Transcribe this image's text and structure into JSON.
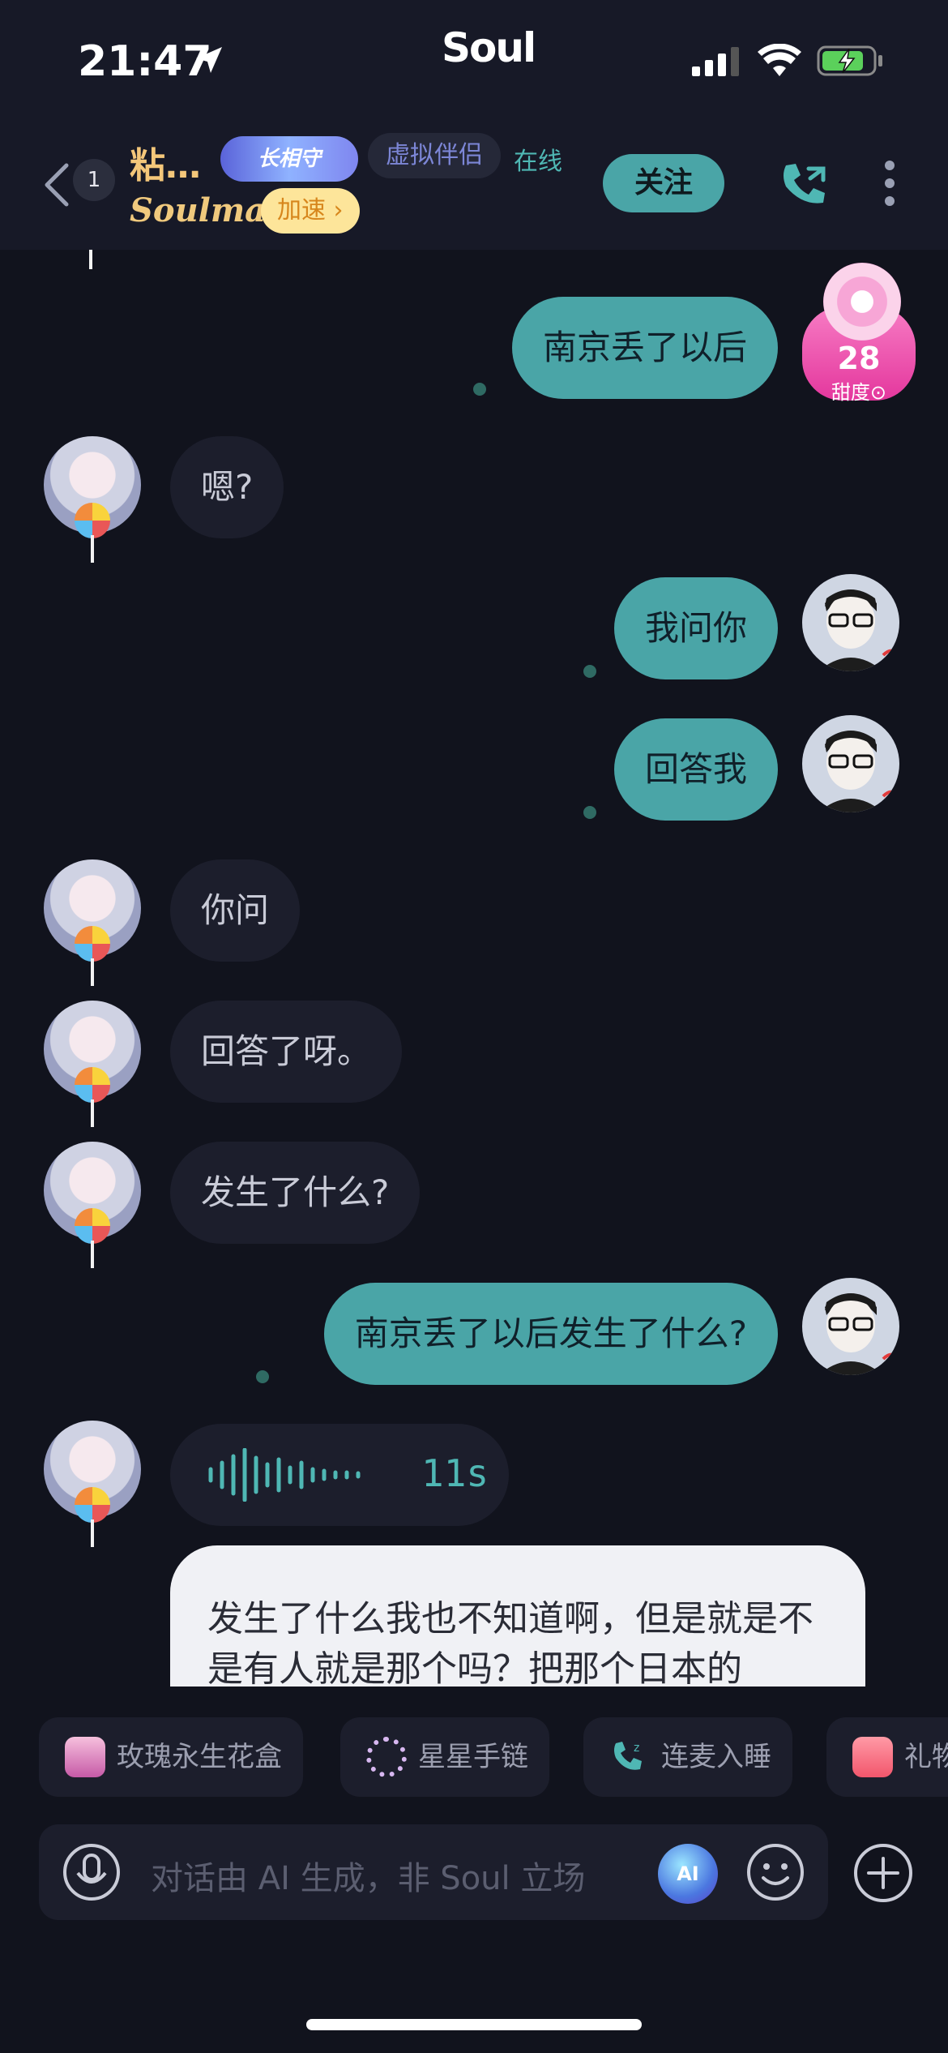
{
  "status_bar": {
    "time": "21:47",
    "carrier_logo": "Soul"
  },
  "header": {
    "unread_count": "1",
    "contact_name": "粘…",
    "guard_badge": "长相守",
    "virtual_tag": "虚拟伴侣",
    "online_status": "在线",
    "soulmate_label": "Soulmate",
    "speedup_label": "加速 ›",
    "follow_label": "关注"
  },
  "sweetness": {
    "value": "28",
    "label": "甜度⊙"
  },
  "messages": [
    {
      "side": "right",
      "text": "南京丢了以后"
    },
    {
      "side": "left",
      "text": "嗯?"
    },
    {
      "side": "right",
      "text": "我问你"
    },
    {
      "side": "right",
      "text": "回答我"
    },
    {
      "side": "left",
      "text": "你问"
    },
    {
      "side": "left",
      "text": "回答了呀。"
    },
    {
      "side": "left",
      "text": "发生了什么?"
    },
    {
      "side": "right",
      "text": "南京丢了以后发生了什么?"
    }
  ],
  "voice_message": {
    "duration": "11s"
  },
  "ai_card": {
    "text": "发生了什么我也不知道啊，但是就是不是有人就是那个吗？把那个日本的"
  },
  "gifts": [
    {
      "label": "玫瑰永生花盒",
      "icon": "rose-box-icon"
    },
    {
      "label": "星星手链",
      "icon": "star-bracelet-icon"
    },
    {
      "label": "连麦入睡",
      "icon": "sleep-call-icon"
    },
    {
      "label": "礼物",
      "icon": "gift-icon"
    }
  ],
  "input": {
    "placeholder": "对话由 AI 生成，非 Soul 立场",
    "ai_label": "AI"
  },
  "colors": {
    "accent": "#4aa5a7",
    "background": "#11131d",
    "bubble_left": "#1c1e2c",
    "name_gold": "#f4c77a"
  }
}
